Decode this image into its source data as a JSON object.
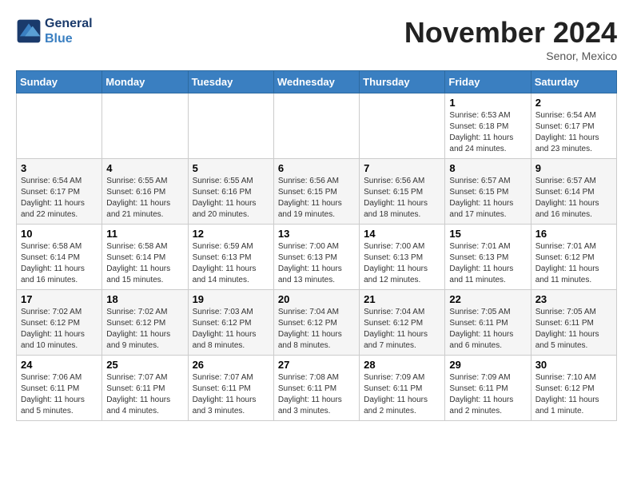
{
  "header": {
    "logo_line1": "General",
    "logo_line2": "Blue",
    "month": "November 2024",
    "location": "Senor, Mexico"
  },
  "days_of_week": [
    "Sunday",
    "Monday",
    "Tuesday",
    "Wednesday",
    "Thursday",
    "Friday",
    "Saturday"
  ],
  "weeks": [
    [
      {
        "day": "",
        "info": ""
      },
      {
        "day": "",
        "info": ""
      },
      {
        "day": "",
        "info": ""
      },
      {
        "day": "",
        "info": ""
      },
      {
        "day": "",
        "info": ""
      },
      {
        "day": "1",
        "info": "Sunrise: 6:53 AM\nSunset: 6:18 PM\nDaylight: 11 hours and 24 minutes."
      },
      {
        "day": "2",
        "info": "Sunrise: 6:54 AM\nSunset: 6:17 PM\nDaylight: 11 hours and 23 minutes."
      }
    ],
    [
      {
        "day": "3",
        "info": "Sunrise: 6:54 AM\nSunset: 6:17 PM\nDaylight: 11 hours and 22 minutes."
      },
      {
        "day": "4",
        "info": "Sunrise: 6:55 AM\nSunset: 6:16 PM\nDaylight: 11 hours and 21 minutes."
      },
      {
        "day": "5",
        "info": "Sunrise: 6:55 AM\nSunset: 6:16 PM\nDaylight: 11 hours and 20 minutes."
      },
      {
        "day": "6",
        "info": "Sunrise: 6:56 AM\nSunset: 6:15 PM\nDaylight: 11 hours and 19 minutes."
      },
      {
        "day": "7",
        "info": "Sunrise: 6:56 AM\nSunset: 6:15 PM\nDaylight: 11 hours and 18 minutes."
      },
      {
        "day": "8",
        "info": "Sunrise: 6:57 AM\nSunset: 6:15 PM\nDaylight: 11 hours and 17 minutes."
      },
      {
        "day": "9",
        "info": "Sunrise: 6:57 AM\nSunset: 6:14 PM\nDaylight: 11 hours and 16 minutes."
      }
    ],
    [
      {
        "day": "10",
        "info": "Sunrise: 6:58 AM\nSunset: 6:14 PM\nDaylight: 11 hours and 16 minutes."
      },
      {
        "day": "11",
        "info": "Sunrise: 6:58 AM\nSunset: 6:14 PM\nDaylight: 11 hours and 15 minutes."
      },
      {
        "day": "12",
        "info": "Sunrise: 6:59 AM\nSunset: 6:13 PM\nDaylight: 11 hours and 14 minutes."
      },
      {
        "day": "13",
        "info": "Sunrise: 7:00 AM\nSunset: 6:13 PM\nDaylight: 11 hours and 13 minutes."
      },
      {
        "day": "14",
        "info": "Sunrise: 7:00 AM\nSunset: 6:13 PM\nDaylight: 11 hours and 12 minutes."
      },
      {
        "day": "15",
        "info": "Sunrise: 7:01 AM\nSunset: 6:13 PM\nDaylight: 11 hours and 11 minutes."
      },
      {
        "day": "16",
        "info": "Sunrise: 7:01 AM\nSunset: 6:12 PM\nDaylight: 11 hours and 11 minutes."
      }
    ],
    [
      {
        "day": "17",
        "info": "Sunrise: 7:02 AM\nSunset: 6:12 PM\nDaylight: 11 hours and 10 minutes."
      },
      {
        "day": "18",
        "info": "Sunrise: 7:02 AM\nSunset: 6:12 PM\nDaylight: 11 hours and 9 minutes."
      },
      {
        "day": "19",
        "info": "Sunrise: 7:03 AM\nSunset: 6:12 PM\nDaylight: 11 hours and 8 minutes."
      },
      {
        "day": "20",
        "info": "Sunrise: 7:04 AM\nSunset: 6:12 PM\nDaylight: 11 hours and 8 minutes."
      },
      {
        "day": "21",
        "info": "Sunrise: 7:04 AM\nSunset: 6:12 PM\nDaylight: 11 hours and 7 minutes."
      },
      {
        "day": "22",
        "info": "Sunrise: 7:05 AM\nSunset: 6:11 PM\nDaylight: 11 hours and 6 minutes."
      },
      {
        "day": "23",
        "info": "Sunrise: 7:05 AM\nSunset: 6:11 PM\nDaylight: 11 hours and 5 minutes."
      }
    ],
    [
      {
        "day": "24",
        "info": "Sunrise: 7:06 AM\nSunset: 6:11 PM\nDaylight: 11 hours and 5 minutes."
      },
      {
        "day": "25",
        "info": "Sunrise: 7:07 AM\nSunset: 6:11 PM\nDaylight: 11 hours and 4 minutes."
      },
      {
        "day": "26",
        "info": "Sunrise: 7:07 AM\nSunset: 6:11 PM\nDaylight: 11 hours and 3 minutes."
      },
      {
        "day": "27",
        "info": "Sunrise: 7:08 AM\nSunset: 6:11 PM\nDaylight: 11 hours and 3 minutes."
      },
      {
        "day": "28",
        "info": "Sunrise: 7:09 AM\nSunset: 6:11 PM\nDaylight: 11 hours and 2 minutes."
      },
      {
        "day": "29",
        "info": "Sunrise: 7:09 AM\nSunset: 6:11 PM\nDaylight: 11 hours and 2 minutes."
      },
      {
        "day": "30",
        "info": "Sunrise: 7:10 AM\nSunset: 6:12 PM\nDaylight: 11 hours and 1 minute."
      }
    ]
  ]
}
